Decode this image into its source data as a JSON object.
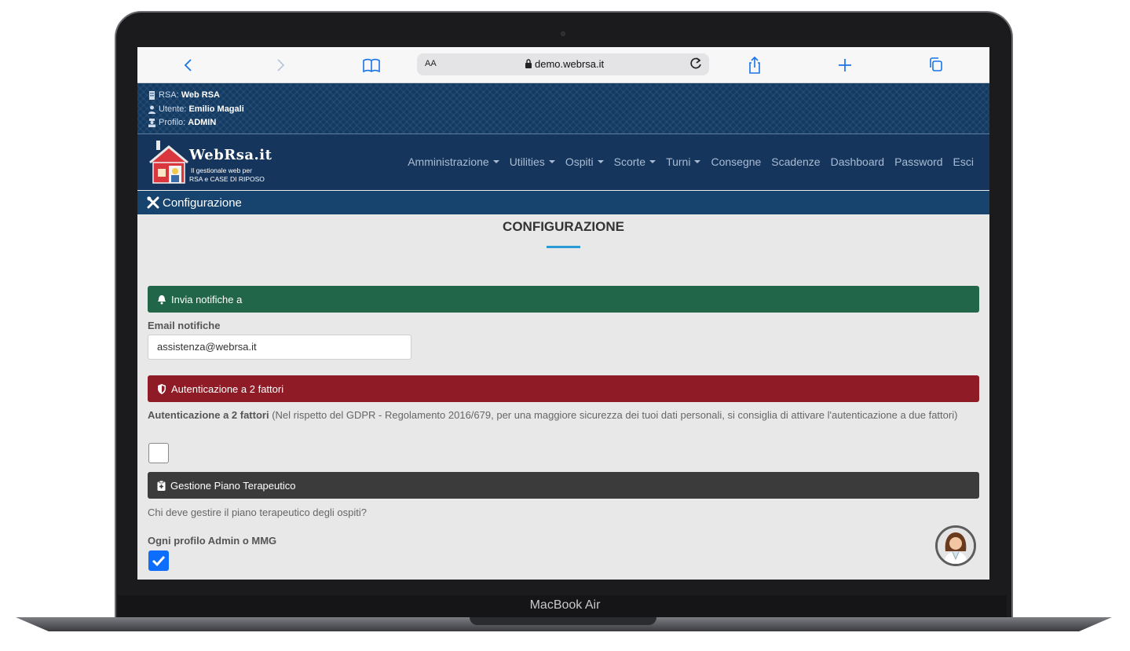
{
  "device": {
    "label": "MacBook Air"
  },
  "browser": {
    "url": "demo.webrsa.it",
    "reader_label": "AA",
    "back_icon": "chevron-left-icon",
    "forward_icon": "chevron-right-icon",
    "bookmarks_icon": "book-icon",
    "reload_icon": "reload-icon",
    "share_icon": "share-icon",
    "new_tab_icon": "plus-icon",
    "tabs_icon": "tabs-icon"
  },
  "info": {
    "rsa_key": "RSA:",
    "rsa_val": "Web RSA",
    "user_key": "Utente:",
    "user_val": "Emilio Magali",
    "profile_key": "Profilo:",
    "profile_val": "ADMIN"
  },
  "logo": {
    "title": "WebRsa.it",
    "sub1": "Il gestionale web per",
    "sub2": "RSA e CASE DI RIPOSO"
  },
  "nav": {
    "items": [
      {
        "label": "Amministrazione",
        "dropdown": true
      },
      {
        "label": "Utilities",
        "dropdown": true
      },
      {
        "label": "Ospiti",
        "dropdown": true
      },
      {
        "label": "Scorte",
        "dropdown": true
      },
      {
        "label": "Turni",
        "dropdown": true
      },
      {
        "label": "Consegne",
        "dropdown": false
      },
      {
        "label": "Scadenze",
        "dropdown": false
      },
      {
        "label": "Dashboard",
        "dropdown": false
      },
      {
        "label": "Password",
        "dropdown": false
      },
      {
        "label": "Esci",
        "dropdown": false
      }
    ]
  },
  "breadcrumb": {
    "label": "Configurazione",
    "icon": "tools-icon"
  },
  "page": {
    "title": "CONFIGURAZIONE"
  },
  "sections": {
    "notifications": {
      "title": "Invia notifiche a",
      "icon": "bell-icon",
      "color": "#216649"
    },
    "twofa": {
      "title": "Autenticazione a 2 fattori",
      "icon": "shield-icon",
      "color": "#8e1b25"
    },
    "therapy": {
      "title": "Gestione Piano Terapeutico",
      "icon": "clipboard-icon",
      "color": "#3b3b3b"
    }
  },
  "form": {
    "email_label": "Email notifiche",
    "email_value": "assistenza@webrsa.it",
    "twofa_label": "Autenticazione a 2 fattori",
    "twofa_note": " (Nel rispetto del GDPR - Regolamento 2016/679, per una maggiore sicurezza dei tuoi dati personali, si consiglia di attivare l'autenticazione a due fattori)",
    "twofa_checked": false,
    "therapy_question": "Chi deve gestire il piano terapeutico degli ospiti?",
    "therapy_option_label": "Ogni profilo Admin o MMG",
    "therapy_option_checked": true
  },
  "colors": {
    "accent": "#2b9bd6",
    "navbar": "#15355c",
    "checkbox": "#0d6efd"
  }
}
